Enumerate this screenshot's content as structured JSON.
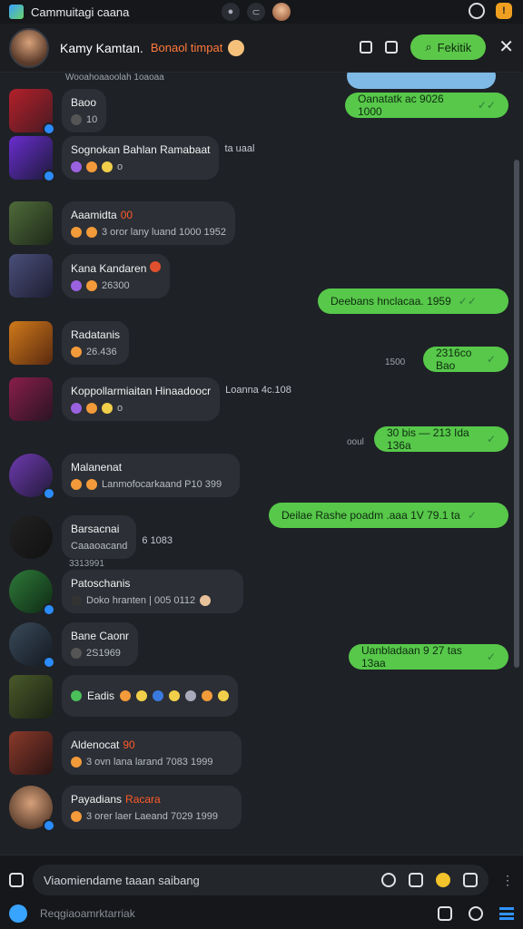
{
  "statusbar": {
    "app_title": "Cammuitagi caana",
    "icons": [
      "app-icon",
      "dot-icon",
      "profile-icon",
      "chat-icon",
      "notification-icon"
    ]
  },
  "header": {
    "name": "Kamy Kamtan.",
    "tag": "Bonaol timpat",
    "search_label": "Fekitik",
    "icons": [
      "video-icon",
      "lock-icon",
      "search-icon",
      "close-icon"
    ]
  },
  "messages_in": [
    {
      "name": "Baoo",
      "sub": "10",
      "reactions": "",
      "hot": ""
    },
    {
      "name": "Sognokan Bahlan Ramabaat",
      "sub": "o",
      "reactions": "ta uaal",
      "hot": ""
    },
    {
      "name": "Aaamidta",
      "sub": "3 oror lany luand 1000 1952",
      "reactions": "",
      "hot": "00"
    },
    {
      "name": "Kana Kandaren",
      "sub": "26300",
      "reactions": "",
      "hot": ""
    },
    {
      "name": "Radatanis",
      "sub": "26.436",
      "reactions": "",
      "hot": ""
    },
    {
      "name": "Koppollarmiaitan Hinaadoocr",
      "sub": "o",
      "reactions": "Loanna  4c.108",
      "hot": ""
    },
    {
      "name": "Malanenat",
      "sub": "Lanmofocarkaand P10 399",
      "reactions": "",
      "hot": ""
    },
    {
      "name": "Barsacnai",
      "sub": "Caaaoacand",
      "reactions": "6 1083",
      "hot": ""
    },
    {
      "name": "Patoschanis",
      "sub": "Doko hranten | 005 0112",
      "reactions": "",
      "hot": ""
    },
    {
      "name": "Bane Caonr",
      "sub": "2S1969",
      "reactions": "",
      "hot": ""
    },
    {
      "name": "Eadis",
      "sub": "",
      "reactions": "",
      "hot": ""
    },
    {
      "name": "Aldenocat",
      "sub": "3 ovn lana larand 7083 1999",
      "reactions": "",
      "hot": "90"
    },
    {
      "name": "Payadians",
      "sub": "3 orer laer Laeand 7029 1999",
      "reactions": "",
      "hot": "Racara"
    }
  ],
  "messages_out": [
    {
      "text": "Oanatatk ac 9026 1000",
      "meta": ""
    },
    {
      "text": "Deebans hnclacaa. 1959",
      "meta": ""
    },
    {
      "text": "2316co Bao",
      "meta": "1500"
    },
    {
      "text": "30 bis — 213 Ida 136a",
      "meta": "ooul"
    },
    {
      "text": "Deilae Rashe poadm .aaa  1V 79.1 ta",
      "meta": ""
    },
    {
      "text": "Uanbladaan  9 27 tas 13aa",
      "meta": ""
    }
  ],
  "meta": {
    "row7_extra": "3313991",
    "top_partial": "Wooahoaaoolah  1oaoaa"
  },
  "composer": {
    "placeholder": "Viaomiendame taaan saibang",
    "hint": "Reqgiaoamrktarriak",
    "icons": [
      "emoji-icon",
      "attach-icon",
      "sticker-icon",
      "smile-icon",
      "shield-icon",
      "more-icon",
      "pen-icon",
      "layout-icon",
      "info-icon",
      "menu-icon"
    ]
  }
}
